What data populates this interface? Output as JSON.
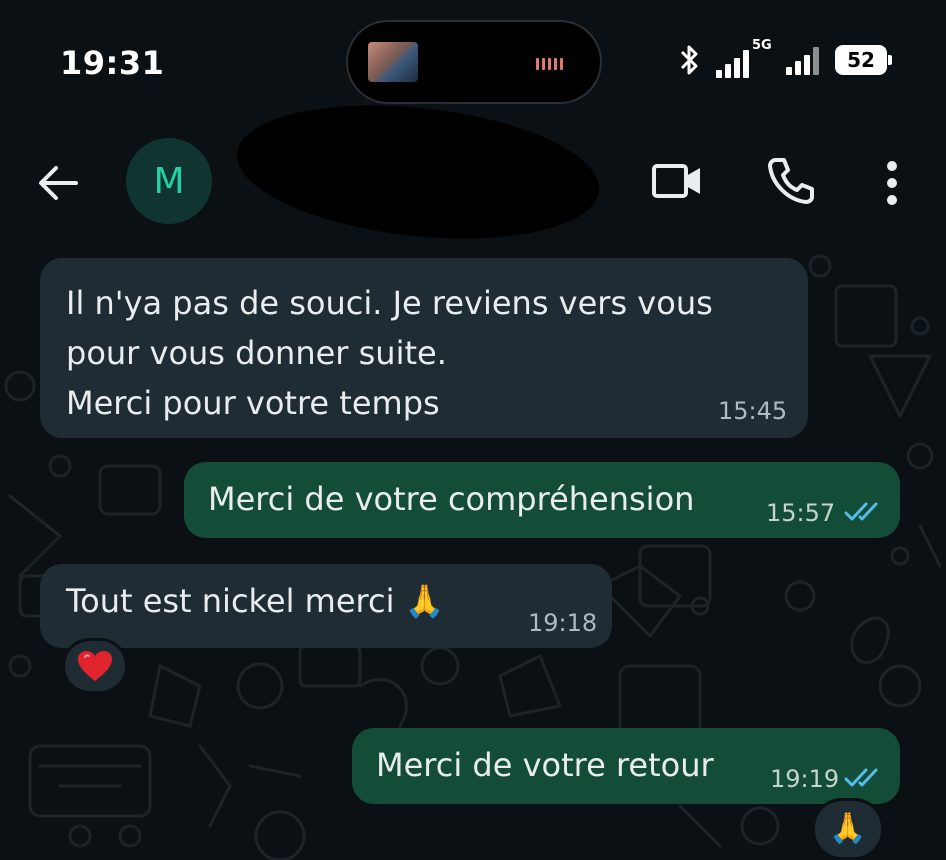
{
  "status_bar": {
    "time": "19:31",
    "network": "5G",
    "battery": "52"
  },
  "header": {
    "avatar_letter": "M"
  },
  "messages": [
    {
      "direction": "in",
      "lines": [
        "Il n'ya pas de souci. Je reviens vers vous",
        "pour vous donner suite.",
        "Merci pour votre temps"
      ],
      "time": "15:45"
    },
    {
      "direction": "out",
      "text": "Merci de votre compréhension",
      "time": "15:57",
      "status": "read"
    },
    {
      "direction": "in",
      "text": "Tout est nickel merci 🙏",
      "time": "19:18",
      "reaction": "heart"
    },
    {
      "direction": "out",
      "text": "Merci de votre retour",
      "time": "19:19",
      "status": "read",
      "reaction": "folded-hands"
    }
  ],
  "colors": {
    "background": "#0b1014",
    "incoming_bubble": "#1f2c33",
    "outgoing_bubble": "#144d37",
    "read_ticks": "#53bdeb",
    "avatar_bg": "#103530",
    "avatar_fg": "#25d0a6"
  }
}
